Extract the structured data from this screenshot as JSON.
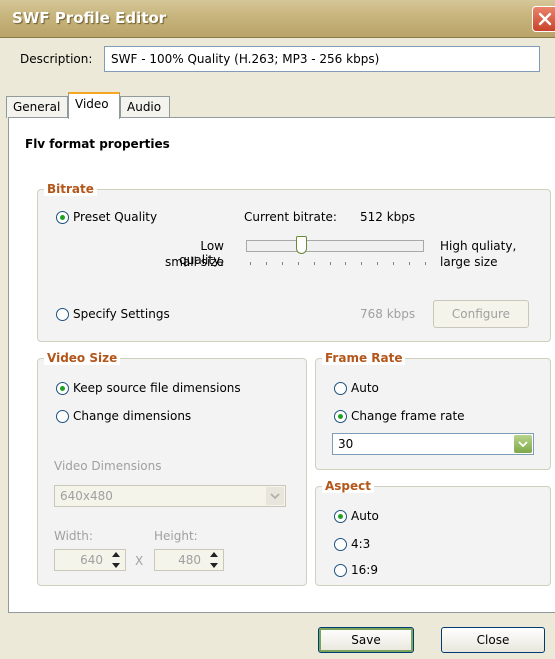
{
  "window": {
    "title": "SWF Profile Editor"
  },
  "description": {
    "label": "Description:",
    "value": "SWF - 100% Quality (H.263; MP3 - 256 kbps)"
  },
  "tabs": [
    {
      "label": "General",
      "active": false
    },
    {
      "label": "Video",
      "active": true
    },
    {
      "label": "Audio",
      "active": false
    }
  ],
  "panel": {
    "heading": "Flv format properties"
  },
  "bitrate": {
    "title": "Bitrate",
    "preset_label": "Preset Quality",
    "preset_checked": true,
    "current_label": "Current bitrate:",
    "current_value": "512 kbps",
    "low_label_1": "Low quality,",
    "low_label_2": "small size",
    "high_label_1": "High quliaty,",
    "high_label_2": "large size",
    "slider_fraction": 0.3,
    "specify_label": "Specify Settings",
    "specify_checked": false,
    "specify_value": "768 kbps",
    "configure_label": "Configure"
  },
  "video_size": {
    "title": "Video Size",
    "keep_label": "Keep source file dimensions",
    "keep_checked": true,
    "change_label": "Change dimensions",
    "change_checked": false,
    "dimensions_label": "Video Dimensions",
    "dimensions_value": "640x480",
    "width_label": "Width:",
    "width_value": "640",
    "height_label": "Height:",
    "height_value": "480",
    "x_label": "X"
  },
  "frame_rate": {
    "title": "Frame Rate",
    "auto_label": "Auto",
    "auto_checked": false,
    "change_label": "Change frame rate",
    "change_checked": true,
    "value": "30"
  },
  "aspect": {
    "title": "Aspect",
    "options": [
      {
        "label": "Auto",
        "checked": true
      },
      {
        "label": "4:3",
        "checked": false
      },
      {
        "label": "16:9",
        "checked": false
      }
    ]
  },
  "footer": {
    "save_label": "Save",
    "close_label": "Close"
  },
  "colors": {
    "group_title": "#b3561a",
    "radio_dot": "#21a121",
    "titlebar": "#c8b67e",
    "close": "#c9432a"
  }
}
